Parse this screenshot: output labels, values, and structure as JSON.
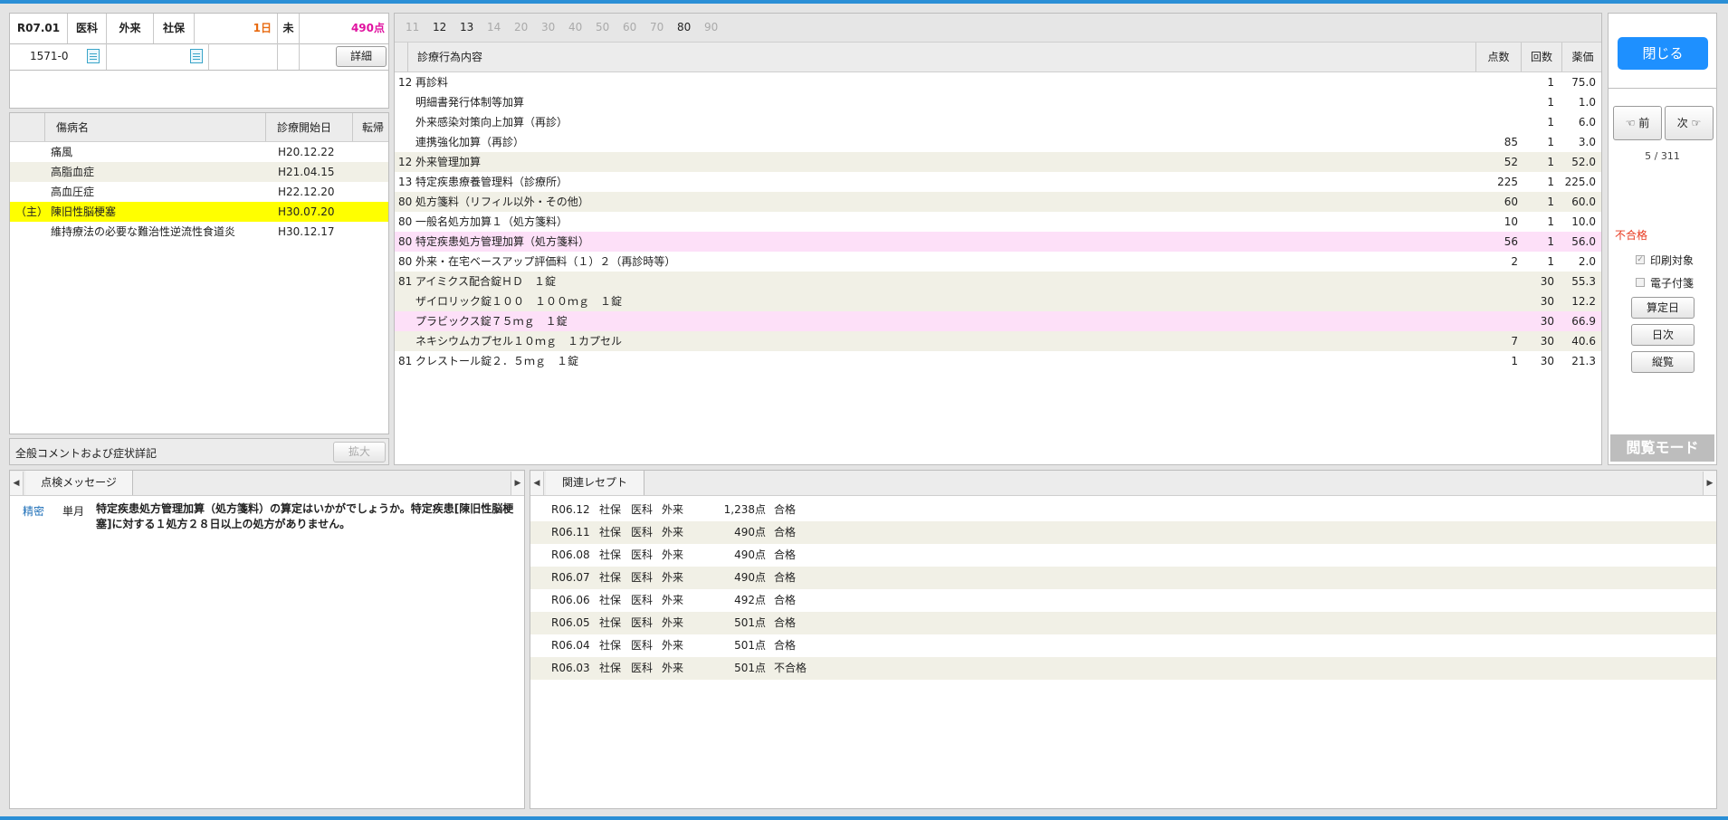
{
  "header": {
    "period": "R07.01",
    "dept": "医科",
    "visit_type": "外来",
    "insurance": "社保",
    "days": "1日",
    "status": "未",
    "points": "490点",
    "patient_no": "1571-0",
    "detail_button": "詳細"
  },
  "diseases": {
    "col_name": "傷病名",
    "col_start": "診療開始日",
    "col_outcome": "転帰",
    "items": [
      {
        "main": "",
        "name": "痛風",
        "start": "H20.12.22",
        "highlight": false
      },
      {
        "main": "",
        "name": "高脂血症",
        "start": "H21.04.15",
        "highlight": false
      },
      {
        "main": "",
        "name": "高血圧症",
        "start": "H22.12.20",
        "highlight": false
      },
      {
        "main": "（主）",
        "name": "陳旧性脳梗塞",
        "start": "H30.07.20",
        "highlight": true
      },
      {
        "main": "",
        "name": "維持療法の必要な難治性逆流性食道炎",
        "start": "H30.12.17",
        "highlight": false
      }
    ]
  },
  "comment": {
    "label": "全般コメントおよび症状詳記",
    "expand_button": "拡大"
  },
  "code_tabs": [
    {
      "label": "11",
      "active": false
    },
    {
      "label": "12",
      "active": true
    },
    {
      "label": "13",
      "active": true
    },
    {
      "label": "14",
      "active": false
    },
    {
      "label": "20",
      "active": false
    },
    {
      "label": "30",
      "active": false
    },
    {
      "label": "40",
      "active": false
    },
    {
      "label": "50",
      "active": false
    },
    {
      "label": "60",
      "active": false
    },
    {
      "label": "70",
      "active": false
    },
    {
      "label": "80",
      "active": true
    },
    {
      "label": "90",
      "active": false
    }
  ],
  "treatment": {
    "col_content": "診療行為内容",
    "col_points": "点数",
    "col_count": "回数",
    "col_price": "薬価",
    "rows": [
      {
        "code": "12",
        "name": "再診料",
        "points": "",
        "count": "1",
        "price": "75.0",
        "style": "plain",
        "indent": false
      },
      {
        "code": "",
        "name": "明細書発行体制等加算",
        "points": "",
        "count": "1",
        "price": "1.0",
        "style": "plain",
        "indent": true
      },
      {
        "code": "",
        "name": "外来感染対策向上加算（再診）",
        "points": "",
        "count": "1",
        "price": "6.0",
        "style": "plain",
        "indent": true
      },
      {
        "code": "",
        "name": "連携強化加算（再診）",
        "points": "85",
        "count": "1",
        "price": "3.0",
        "style": "plain",
        "indent": true
      },
      {
        "code": "12",
        "name": "外来管理加算",
        "points": "52",
        "count": "1",
        "price": "52.0",
        "style": "alt",
        "indent": false
      },
      {
        "code": "13",
        "name": "特定疾患療養管理料（診療所）",
        "points": "225",
        "count": "1",
        "price": "225.0",
        "style": "plain",
        "indent": false
      },
      {
        "code": "80",
        "name": "処方箋料（リフィル以外・その他）",
        "points": "60",
        "count": "1",
        "price": "60.0",
        "style": "alt",
        "indent": false
      },
      {
        "code": "80",
        "name": "一般名処方加算１（処方箋料）",
        "points": "10",
        "count": "1",
        "price": "10.0",
        "style": "plain",
        "indent": false
      },
      {
        "code": "80",
        "name": "特定疾患処方管理加算（処方箋料）",
        "points": "56",
        "count": "1",
        "price": "56.0",
        "style": "pink",
        "indent": false
      },
      {
        "code": "80",
        "name": "外来・在宅ベースアップ評価料（１）２（再診時等）",
        "points": "2",
        "count": "1",
        "price": "2.0",
        "style": "plain",
        "indent": false
      },
      {
        "code": "81",
        "name": "アイミクス配合錠ＨＤ　１錠",
        "points": "",
        "count": "30",
        "price": "55.3",
        "style": "alt",
        "indent": false
      },
      {
        "code": "",
        "name": "ザイロリック錠１００　１００ｍｇ　１錠",
        "points": "",
        "count": "30",
        "price": "12.2",
        "style": "alt",
        "indent": true
      },
      {
        "code": "",
        "name": "プラビックス錠７５ｍｇ　１錠",
        "points": "",
        "count": "30",
        "price": "66.9",
        "style": "pink",
        "indent": true
      },
      {
        "code": "",
        "name": "ネキシウムカプセル１０ｍｇ　１カプセル",
        "points": "7",
        "count": "30",
        "price": "40.6",
        "style": "alt",
        "indent": true
      },
      {
        "code": "81",
        "name": "クレストール錠２．５ｍｇ　１錠",
        "points": "1",
        "count": "30",
        "price": "21.3",
        "style": "plain",
        "indent": false
      }
    ]
  },
  "sidebar": {
    "close_button": "閉じる",
    "prev_button": "前",
    "next_button": "次",
    "counter": "5 / 311",
    "result": "不合格",
    "print_target": "印刷対象",
    "e_note": "電子付箋",
    "calc_day_button": "算定日",
    "daily_button": "日次",
    "vertical_button": "縦覧",
    "mode_label": "閲覧モード"
  },
  "messages": {
    "tab_label": "点検メッセージ",
    "items": [
      {
        "category": "精密",
        "scope": "単月",
        "text": "特定疾患処方管理加算（処方箋料）の算定はいかがでしょうか。特定疾患[陳旧性脳梗塞]に対する１処方２８日以上の処方がありません。"
      }
    ]
  },
  "related": {
    "tab_label": "関連レセプト",
    "rows": [
      {
        "period": "R06.12",
        "insurance": "社保",
        "dept": "医科",
        "visit": "外来",
        "points": "1,238点",
        "result": "合格"
      },
      {
        "period": "R06.11",
        "insurance": "社保",
        "dept": "医科",
        "visit": "外来",
        "points": "490点",
        "result": "合格"
      },
      {
        "period": "R06.08",
        "insurance": "社保",
        "dept": "医科",
        "visit": "外来",
        "points": "490点",
        "result": "合格"
      },
      {
        "period": "R06.07",
        "insurance": "社保",
        "dept": "医科",
        "visit": "外来",
        "points": "490点",
        "result": "合格"
      },
      {
        "period": "R06.06",
        "insurance": "社保",
        "dept": "医科",
        "visit": "外来",
        "points": "492点",
        "result": "合格"
      },
      {
        "period": "R06.05",
        "insurance": "社保",
        "dept": "医科",
        "visit": "外来",
        "points": "501点",
        "result": "合格"
      },
      {
        "period": "R06.04",
        "insurance": "社保",
        "dept": "医科",
        "visit": "外来",
        "points": "501点",
        "result": "合格"
      },
      {
        "period": "R06.03",
        "insurance": "社保",
        "dept": "医科",
        "visit": "外来",
        "points": "501点",
        "result": "不合格"
      }
    ]
  },
  "colors": {
    "accent": "#2b8fd6",
    "fail": "#e8381e",
    "points": "#e0119f",
    "days": "#e86a10",
    "highlight": "#ffff00",
    "pink_row": "#fde0f8"
  }
}
